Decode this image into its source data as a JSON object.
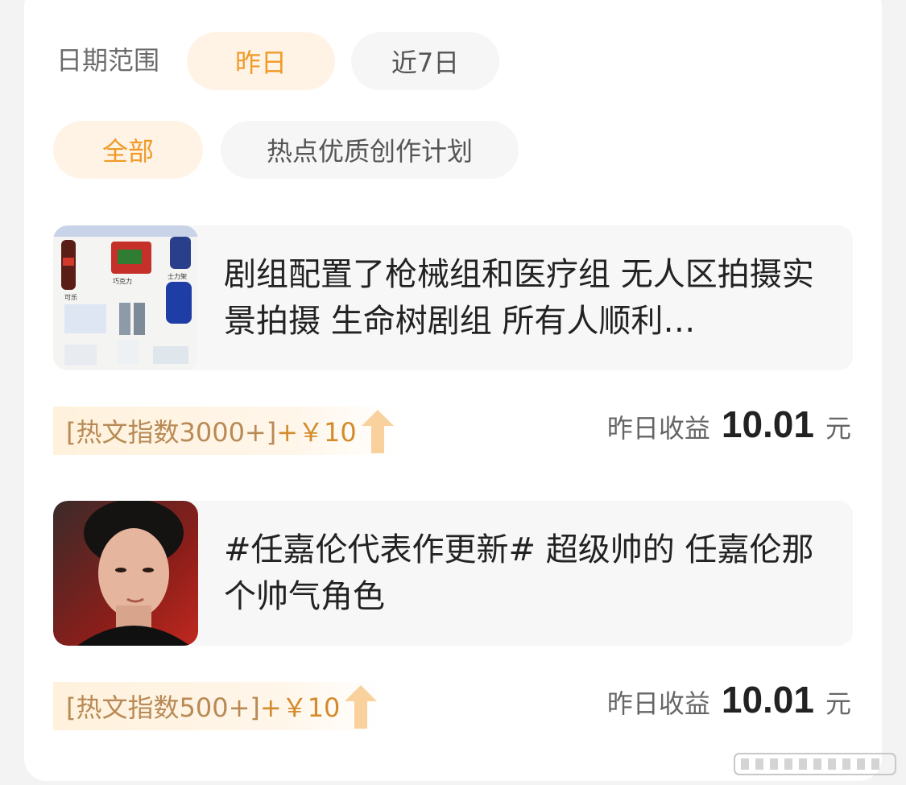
{
  "filters": {
    "date_label": "日期范围",
    "date_options": [
      "昨日",
      "近7日"
    ],
    "category_options": [
      "全部",
      "热点优质创作计划"
    ]
  },
  "articles": [
    {
      "title": "剧组配置了枪械组和医疗组 无人区拍摄实景拍摄 生命树剧组 所有人顺利…",
      "thumbnail": "supplies-photo",
      "bonus_text": "[热文指数3000+]",
      "bonus_amount": "+￥10",
      "earnings_label": "昨日收益",
      "earnings_value": "10.01",
      "earnings_unit": "元"
    },
    {
      "title": "#任嘉伦代表作更新# 超级帅的 任嘉伦那个帅气角色",
      "thumbnail": "actor-portrait",
      "bonus_text": "[热文指数500+]",
      "bonus_amount": "+￥10",
      "earnings_label": "昨日收益",
      "earnings_value": "10.01",
      "earnings_unit": "元"
    }
  ],
  "colors": {
    "accent": "#f09a28",
    "chip_active_bg": "#fff3e6",
    "chip_inactive_bg": "#f6f6f6",
    "card_bg": "#ffffff"
  }
}
